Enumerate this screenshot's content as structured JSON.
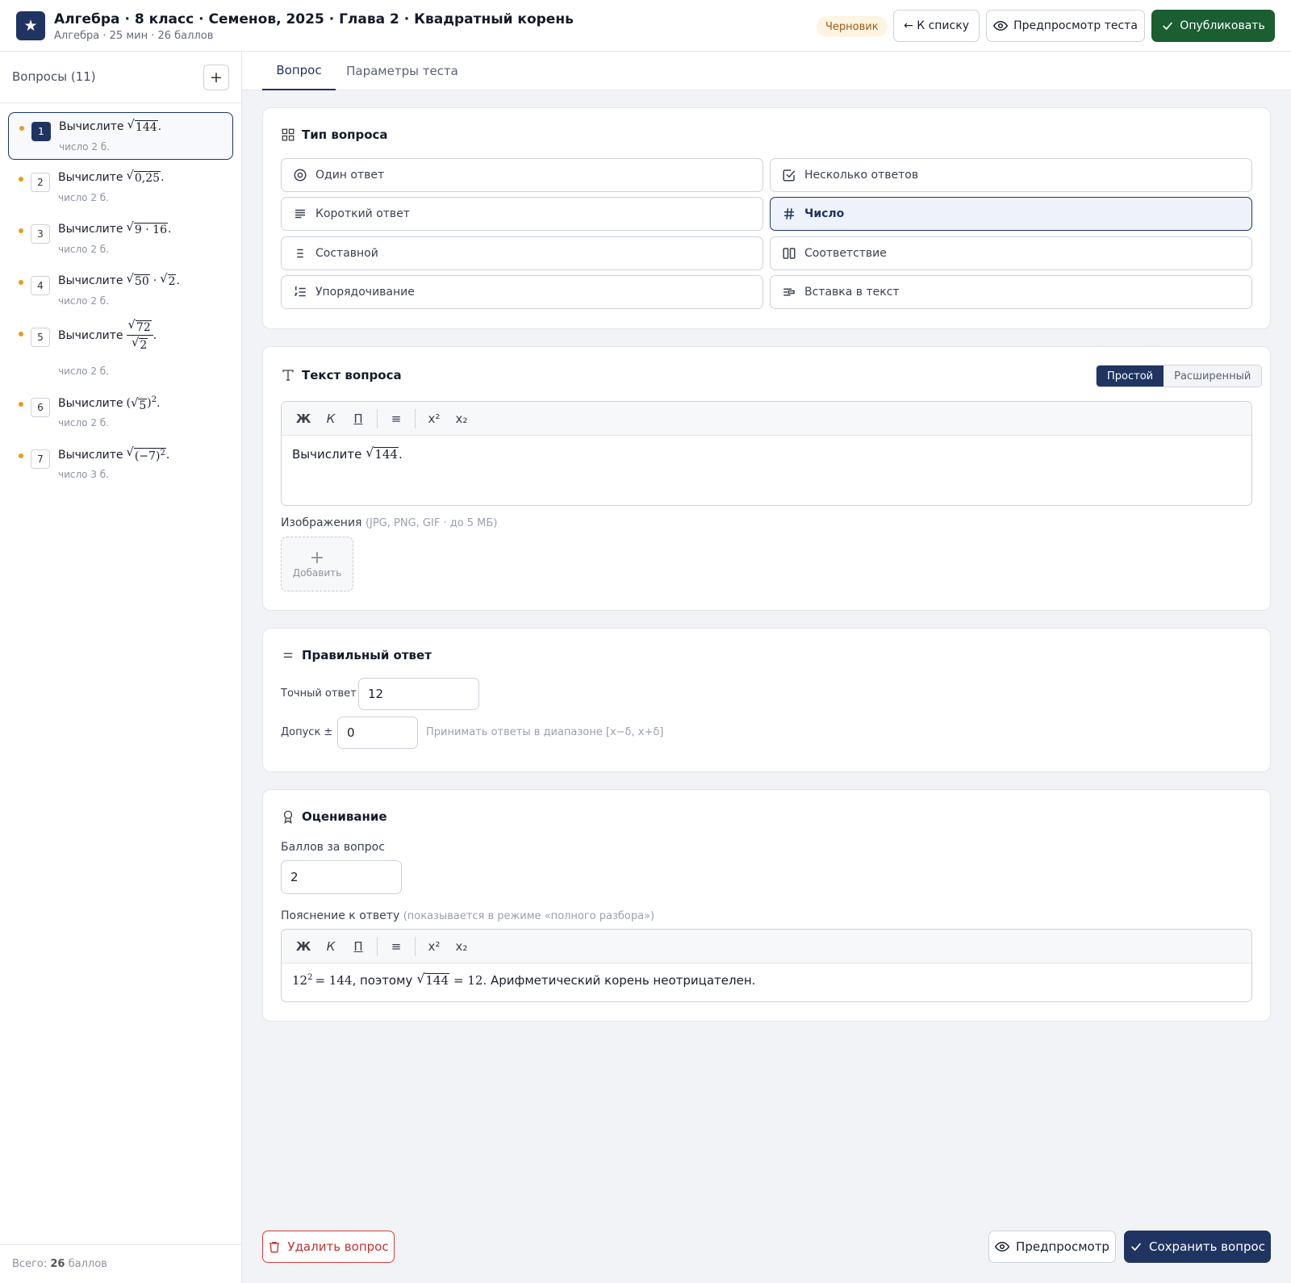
{
  "header": {
    "title": "Алгебра · 8 класс · Семенов, 2025 · Глава 2 · Квадратный корень",
    "subtitle": "Алгебра · 25 мин · 26 баллов",
    "status_badge": "Черновик",
    "back_label": "← К списку",
    "preview_label": "Предпросмотр теста",
    "publish_label": "Опубликовать"
  },
  "sidebar": {
    "title": "Вопросы (11)",
    "add_label": "+",
    "footer_prefix": "Всего: ",
    "footer_value": "26",
    "footer_suffix": " баллов",
    "questions": [
      {
        "num": "1",
        "prefix": "Вычислите",
        "radicand": "144",
        "tail": ".",
        "meta": "число  2 б."
      },
      {
        "num": "2",
        "prefix": "Вычислите",
        "radicand": "0,25",
        "tail": ".",
        "meta": "число  2 б."
      },
      {
        "num": "3",
        "prefix": "Вычислите",
        "radicand": "9 · 16",
        "tail": ".",
        "meta": "число  2 б."
      },
      {
        "num": "4",
        "prefix": "Вычислите",
        "radicand": "50",
        "middle": "·",
        "radicand2": "2",
        "tail": ".",
        "meta": "число  2 б."
      },
      {
        "num": "5",
        "prefix": "Вычислите",
        "numerator": "72",
        "denominator": "2",
        "tail": ".",
        "meta": "число  2 б."
      },
      {
        "num": "6",
        "prefix": "Вычислите",
        "open": "(",
        "radicand": "5",
        "close": ")",
        "power": "2",
        "tail": ".",
        "meta": "число  2 б."
      },
      {
        "num": "7",
        "prefix": "Вычислите",
        "radicand": "(−7)",
        "power": "2",
        "tail": ".",
        "meta": "число  3 б."
      }
    ]
  },
  "tabs": [
    {
      "label": "Вопрос"
    },
    {
      "label": "Параметры теста"
    }
  ],
  "question_type": {
    "title": "Тип вопроса",
    "options": [
      {
        "label": "Один ответ",
        "icon": "radio-icon"
      },
      {
        "label": "Несколько ответов",
        "icon": "checkbox-icon"
      },
      {
        "label": "Короткий ответ",
        "icon": "text-lines-icon"
      },
      {
        "label": "Число",
        "icon": "hash-icon"
      },
      {
        "label": "Составной",
        "icon": "list-icon"
      },
      {
        "label": "Соответствие",
        "icon": "columns-icon"
      },
      {
        "label": "Упорядочивание",
        "icon": "ordered-list-icon"
      },
      {
        "label": "Вставка в текст",
        "icon": "text-insert-icon"
      }
    ],
    "selected": "Число"
  },
  "question_text": {
    "title": "Текст вопроса",
    "mode_simple": "Простой",
    "mode_advanced": "Расширенный",
    "toolbar": {
      "bold": "Ж",
      "italic": "К",
      "underline": "П",
      "list": "≡",
      "sup": "x²",
      "sub": "x₂"
    },
    "prefix": "Вычислите",
    "radicand": "144",
    "tail": ".",
    "images_label": "Изображения",
    "images_hint": "(JPG, PNG, GIF · до 5 МБ)",
    "add_image_label": "Добавить"
  },
  "correct_answer": {
    "title": "Правильный ответ",
    "exact_label": "Точный ответ",
    "exact_value": "12",
    "tolerance_label": "Допуск ±",
    "tolerance_value": "0",
    "tolerance_hint": "Принимать ответы в диапазоне [x−δ, x+δ]"
  },
  "grading": {
    "title": "Оценивание",
    "points_label": "Баллов за вопрос",
    "points_value": "2",
    "explanation_label": "Пояснение к ответу",
    "explanation_hint": "(показывается в режиме «полного разбора»)",
    "explanation": {
      "base": "12",
      "power": "2",
      "eq1": "= 144",
      "words": ", поэтому",
      "radicand": "144",
      "eq2": "= 12",
      "tail": ". Арифметический корень неотрицателен."
    }
  },
  "actions": {
    "delete_label": "Удалить вопрос",
    "preview_label": "Предпросмотр",
    "save_label": "Сохранить вопрос"
  },
  "colors": {
    "brand": "#1f3461",
    "publish": "#1a5e31",
    "draft_badge_bg": "#fdf4e2",
    "danger": "#c53030",
    "dot": "#eb9a1d"
  }
}
